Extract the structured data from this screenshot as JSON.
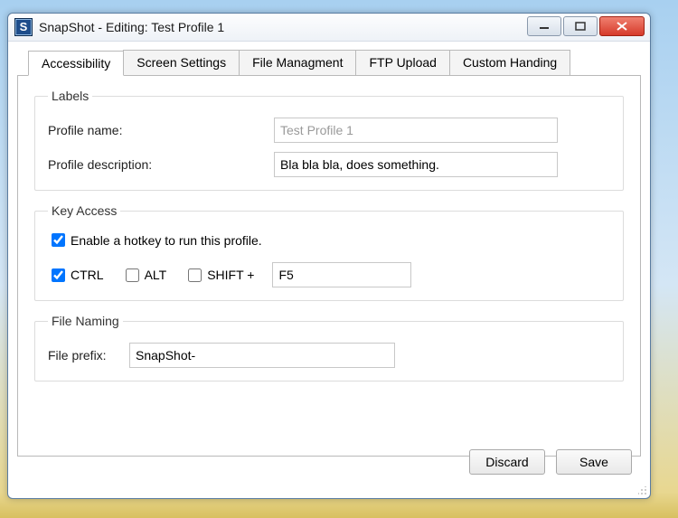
{
  "window": {
    "app_icon_letter": "S",
    "title": "SnapShot - Editing: Test Profile 1"
  },
  "tabs": [
    {
      "label": "Accessibility",
      "active": true
    },
    {
      "label": "Screen Settings",
      "active": false
    },
    {
      "label": "File Managment",
      "active": false
    },
    {
      "label": "FTP Upload",
      "active": false
    },
    {
      "label": "Custom Handing",
      "active": false
    }
  ],
  "groups": {
    "labels": {
      "legend": "Labels",
      "profile_name_label": "Profile name:",
      "profile_name_value": "Test Profile 1",
      "profile_desc_label": "Profile description:",
      "profile_desc_value": "Bla bla bla, does something."
    },
    "key_access": {
      "legend": "Key Access",
      "enable_label": "Enable a hotkey to run this profile.",
      "enable_checked": true,
      "ctrl_label": "CTRL",
      "ctrl_checked": true,
      "alt_label": "ALT",
      "alt_checked": false,
      "shift_label": "SHIFT +",
      "shift_checked": false,
      "key_value": "F5"
    },
    "file_naming": {
      "legend": "File Naming",
      "prefix_label": "File prefix:",
      "prefix_value": "SnapShot-"
    }
  },
  "buttons": {
    "discard": "Discard",
    "save": "Save"
  }
}
